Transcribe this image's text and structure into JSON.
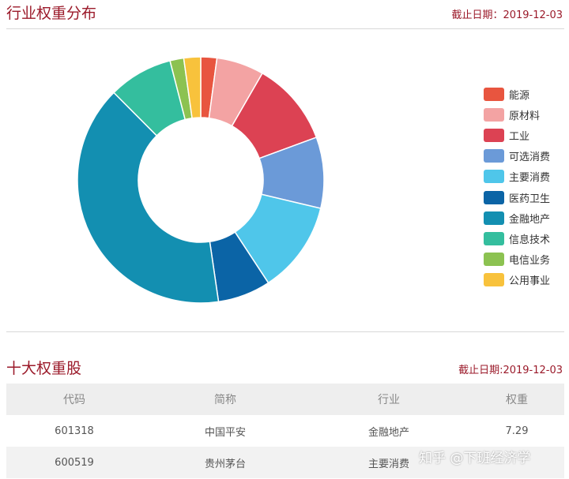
{
  "section1": {
    "title": "行业权重分布",
    "date": "截止日期：2019-12-03"
  },
  "chart_data": {
    "type": "pie",
    "donut": true,
    "legend_position": "right",
    "categories": [
      "能源",
      "原材料",
      "工业",
      "可选消费",
      "主要消费",
      "医药卫生",
      "金融地产",
      "信息技术",
      "电信业务",
      "公用事业"
    ],
    "values": [
      2.1,
      6.2,
      11.0,
      9.3,
      12.0,
      6.9,
      39.7,
      8.4,
      1.8,
      2.2
    ],
    "colors": [
      "#e8553f",
      "#f3a3a3",
      "#dc4253",
      "#6b9ad8",
      "#4fc6ea",
      "#0b64a6",
      "#138fb1",
      "#34be9e",
      "#8cc251",
      "#f8c23c"
    ]
  },
  "section2": {
    "title": "十大权重股",
    "date": "截止日期:2019-12-03"
  },
  "table": {
    "headers": [
      "代码",
      "简称",
      "行业",
      "权重"
    ],
    "rows": [
      [
        "601318",
        "中国平安",
        "金融地产",
        "7.29"
      ],
      [
        "600519",
        "贵州茅台",
        "主要消费",
        ""
      ]
    ]
  },
  "watermark": "知乎 @下班经济学"
}
